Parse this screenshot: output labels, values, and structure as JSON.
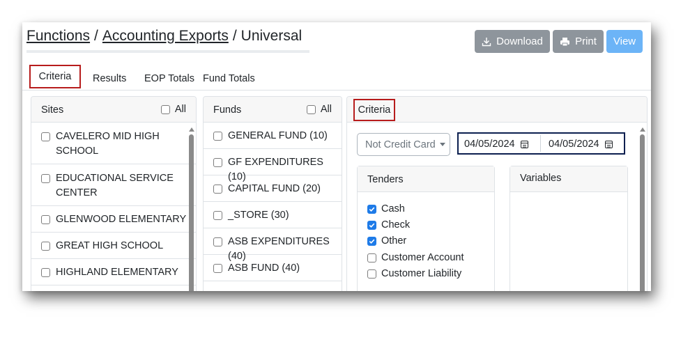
{
  "breadcrumb": {
    "part1": "Functions",
    "sep": "/",
    "part2": "Accounting Exports",
    "part3": "Universal"
  },
  "toolbar": {
    "download_label": "Download",
    "print_label": "Print",
    "view_label": "View"
  },
  "tabs": [
    "Criteria",
    "Results",
    "EOP Totals",
    "Fund Totals"
  ],
  "sites": {
    "title": "Sites",
    "all_label": "All",
    "items": [
      [
        "CAVELERO MID HIGH",
        "SCHOOL"
      ],
      [
        "EDUCATIONAL SERVICE",
        "CENTER"
      ],
      [
        "GLENWOOD ELEMENTARY"
      ],
      [
        "GREAT HIGH SCHOOL"
      ],
      [
        "HIGHLAND ELEMENTARY"
      ]
    ]
  },
  "funds": {
    "title": "Funds",
    "all_label": "All",
    "items": [
      "GENERAL FUND (10)",
      "GF EXPENDITURES (10)",
      "CAPITAL FUND (20)",
      "_STORE (30)",
      "ASB EXPENDITURES (40)",
      "ASB FUND (40)"
    ]
  },
  "criteria": {
    "title": "Criteria",
    "card_type": "Not Credit Card",
    "date_from": "04/05/2024",
    "date_to": "04/05/2024",
    "tenders_title": "Tenders",
    "tenders": [
      {
        "label": "Cash",
        "checked": true
      },
      {
        "label": "Check",
        "checked": true
      },
      {
        "label": "Other",
        "checked": true
      },
      {
        "label": "Customer Account",
        "checked": false
      },
      {
        "label": "Customer Liability",
        "checked": false
      }
    ],
    "variables_title": "Variables"
  },
  "colors": {
    "highlight_red": "#b71c1c",
    "highlight_navy": "#0c1f4f",
    "view_button": "#6cb4f7",
    "secondary_button": "#8e959c",
    "checkbox_checked": "#1e7be8"
  },
  "icons": {
    "download": "download-icon",
    "print": "printer-icon",
    "calendar": "calendar-icon"
  }
}
